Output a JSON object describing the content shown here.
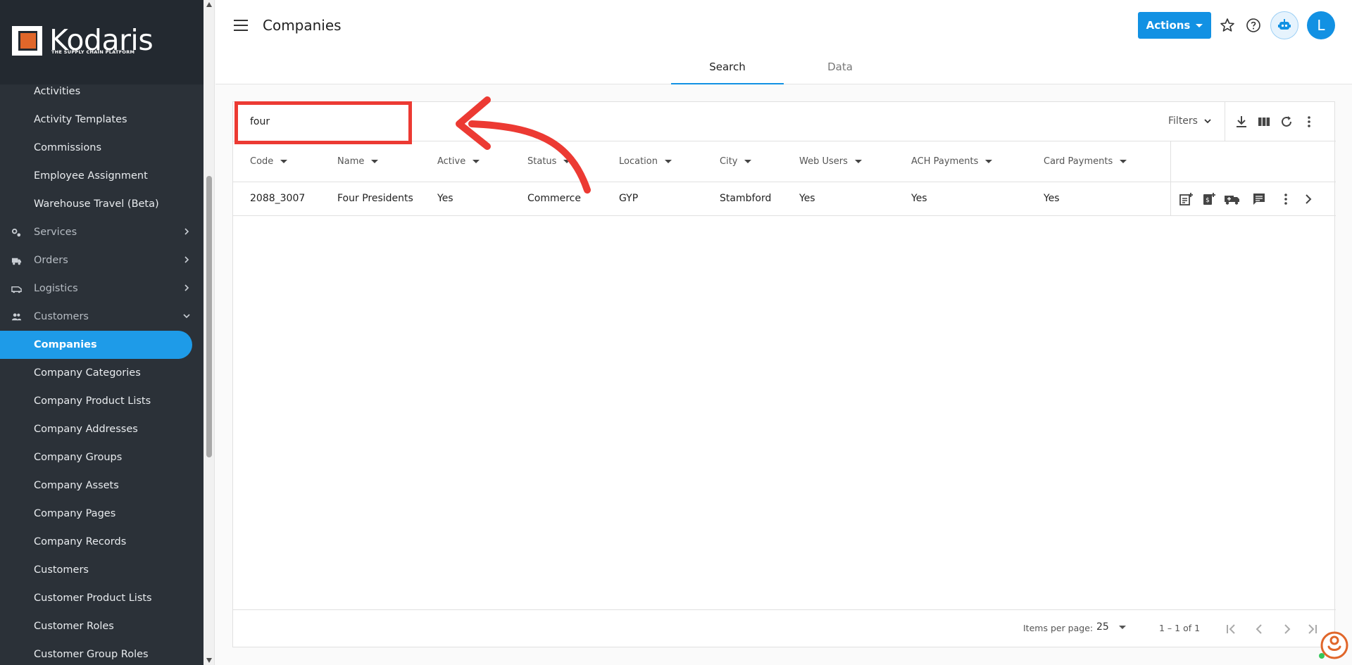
{
  "brand": {
    "name": "Kodaris",
    "tagline": "THE SUPPLY CHAIN PLATFORM"
  },
  "sidebar": {
    "items": [
      {
        "label": "Activities",
        "type": "sub"
      },
      {
        "label": "Activity Templates",
        "type": "sub"
      },
      {
        "label": "Commissions",
        "type": "sub"
      },
      {
        "label": "Employee Assignment",
        "type": "sub"
      },
      {
        "label": "Warehouse Travel (Beta)",
        "type": "sub"
      },
      {
        "label": "Services",
        "type": "section",
        "icon": "gears-icon"
      },
      {
        "label": "Orders",
        "type": "section",
        "icon": "truck-icon"
      },
      {
        "label": "Logistics",
        "type": "section",
        "icon": "van-icon"
      },
      {
        "label": "Customers",
        "type": "section",
        "icon": "people-icon",
        "expanded": true
      },
      {
        "label": "Companies",
        "type": "sub",
        "active": true
      },
      {
        "label": "Company Categories",
        "type": "sub"
      },
      {
        "label": "Company Product Lists",
        "type": "sub"
      },
      {
        "label": "Company Addresses",
        "type": "sub"
      },
      {
        "label": "Company Groups",
        "type": "sub"
      },
      {
        "label": "Company Assets",
        "type": "sub"
      },
      {
        "label": "Company Pages",
        "type": "sub"
      },
      {
        "label": "Company Records",
        "type": "sub"
      },
      {
        "label": "Customers",
        "type": "sub"
      },
      {
        "label": "Customer Product Lists",
        "type": "sub"
      },
      {
        "label": "Customer Roles",
        "type": "sub"
      },
      {
        "label": "Customer Group Roles",
        "type": "sub"
      }
    ]
  },
  "header": {
    "title": "Companies",
    "actions_label": "Actions",
    "avatar_initial": "L",
    "tabs": [
      {
        "label": "Search",
        "active": true
      },
      {
        "label": "Data",
        "active": false
      }
    ]
  },
  "search": {
    "value": "four",
    "filters_label": "Filters"
  },
  "table": {
    "columns": [
      "Code",
      "Name",
      "Active",
      "Status",
      "Location",
      "City",
      "Web Users",
      "ACH Payments",
      "Card Payments"
    ],
    "rows": [
      {
        "code": "2088_3007",
        "name": "Four Presidents",
        "active": "Yes",
        "status": "Commerce",
        "location": "GYP",
        "city": "Stambford",
        "web_users": "Yes",
        "ach_payments": "Yes",
        "card_payments": "Yes"
      }
    ]
  },
  "pagination": {
    "items_per_page_label": "Items per page:",
    "items_per_page": "25",
    "range": "1 – 1 of 1"
  },
  "colors": {
    "accent": "#1291e3",
    "sidebar_bg": "#2b3138",
    "annotation": "#ec3a33"
  }
}
